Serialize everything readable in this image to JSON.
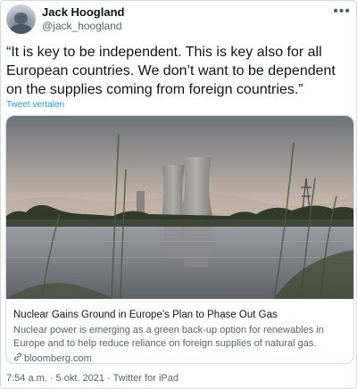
{
  "author": {
    "name": "Jack Hoogland",
    "handle": "@jack_hoogland",
    "avatar_icon": "avatar-photo"
  },
  "more_icon": "ellipsis-icon",
  "tweet": {
    "text": "“It is key to be independent. This is key also for all European countries. We don’t want to be dependent on the supplies coming from foreign countries.”",
    "translate_label": "Tweet vertalen"
  },
  "card": {
    "image_alt": "cooling-towers-by-river-photo",
    "title": "Nuclear Gains Ground in Europe’s Plan to Phase Out Gas",
    "description": "Nuclear power is emerging as a green back-up option for renewables in Europe and to help reduce reliance on foreign supplies of natural gas.",
    "domain": "bloomberg.com",
    "domain_icon": "link-icon"
  },
  "footer": {
    "time": "7:54 a.m.",
    "separator": "·",
    "date": "5 okt. 2021",
    "source": "Twitter for iPad"
  },
  "colors": {
    "link": "#1d9bf0",
    "secondary_text": "#536471",
    "border": "#cfd9de"
  }
}
